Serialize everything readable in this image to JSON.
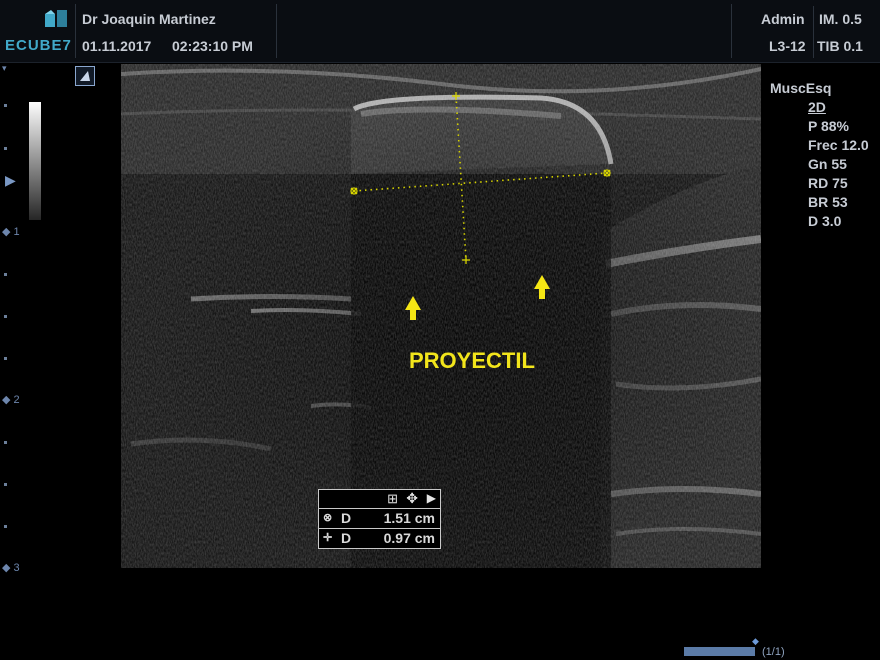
{
  "header": {
    "logo": "ECUBE7",
    "doctor": "Dr Joaquin Martinez",
    "date": "01.11.2017",
    "time": "02:23:10 PM",
    "user": "Admin",
    "im": "IM. 0.5",
    "probe": "L3-12",
    "tib": "TIB 0.1"
  },
  "depth_scale": {
    "labels": [
      "1",
      "2",
      "3"
    ]
  },
  "params": {
    "preset": "MuscEsq",
    "mode": "2D",
    "power": "P 88%",
    "freq": "Frec 12.0",
    "gain": "Gn 55",
    "dyn_range": "RD 75",
    "br": "BR 53",
    "d": "D 3.0"
  },
  "annotation": {
    "label": "PROYECTIL",
    "color": "#f2e51b"
  },
  "measurements": [
    {
      "symbol": "⊗",
      "type": "D",
      "value": "1.51 cm"
    },
    {
      "symbol": "✛",
      "type": "D",
      "value": "0.97 cm"
    }
  ],
  "footer": {
    "page": "(1/1)",
    "progress": 1.0
  },
  "colors": {
    "accent": "#41a9c9",
    "caliper": "#d6d300",
    "arrow": "#f5e614"
  }
}
